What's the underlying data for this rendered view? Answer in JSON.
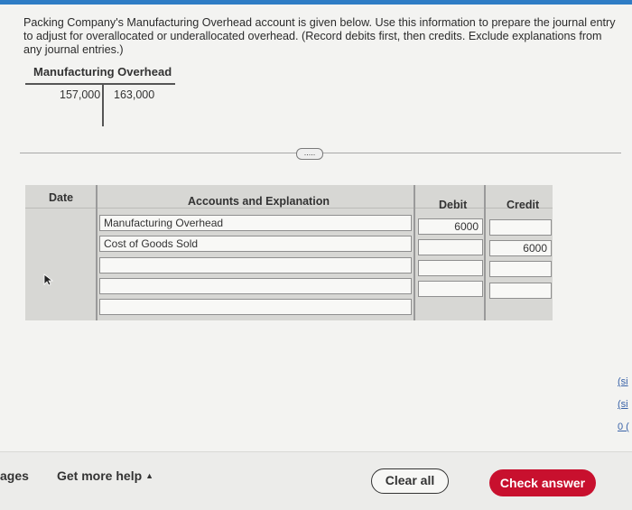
{
  "question": {
    "text": "Packing Company's Manufacturing Overhead account is given below. Use this information to prepare the journal entry to adjust for overallocated or underallocated overhead. (Record debits first, then credits. Exclude explanations from any journal entries.)"
  },
  "t_account": {
    "title": "Manufacturing Overhead",
    "debit": "157,000",
    "credit": "163,000"
  },
  "more_button": {
    "label": "....."
  },
  "journal": {
    "headers": {
      "date": "Date",
      "accounts": "Accounts and Explanation",
      "debit": "Debit",
      "credit": "Credit"
    },
    "rows": [
      {
        "account": "Manufacturing Overhead",
        "debit": "6000",
        "credit": ""
      },
      {
        "account": "Cost of Goods Sold",
        "debit": "",
        "credit": "6000"
      },
      {
        "account": "",
        "debit": "",
        "credit": ""
      },
      {
        "account": "",
        "debit": "",
        "credit": ""
      },
      {
        "account": "",
        "debit": "",
        "credit": ""
      }
    ]
  },
  "footer": {
    "pages_label": "ages",
    "help_label": "Get more help",
    "help_caret": "▲",
    "clear_label": "Clear all",
    "check_label": "Check answer"
  },
  "side_links": [
    "(si",
    "(si",
    "0 ("
  ],
  "colors": {
    "accent": "#2e7cc5",
    "check_button": "#c8102e",
    "link": "#3a63a8"
  }
}
